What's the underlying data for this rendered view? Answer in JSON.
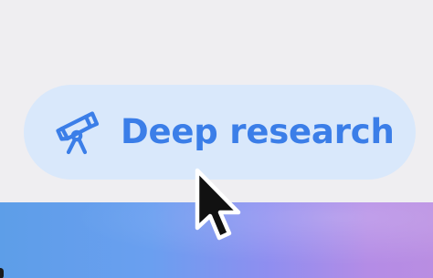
{
  "chip": {
    "label": "Deep research",
    "icon": "telescope-icon",
    "text_color": "#3b7ee8",
    "background_color": "#d9e8fb"
  },
  "cursor": {
    "icon": "mouse-pointer-icon"
  },
  "colors": {
    "page_background": "#efeef1",
    "gradient_start": "#5d9ee8",
    "gradient_end": "#b98de2"
  }
}
